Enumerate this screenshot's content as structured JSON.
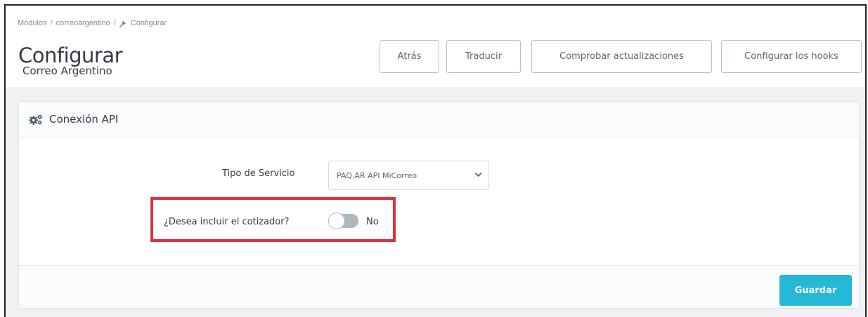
{
  "breadcrumb": {
    "items": [
      "Módulos",
      "correoargentino",
      "Configurar"
    ],
    "separator": "/"
  },
  "header": {
    "title": "Configurar",
    "subtitle": "Correo Argentino"
  },
  "toolbar": {
    "back_label": "Atrás",
    "translate_label": "Traducir",
    "check_updates_label": "Comprobar actualizaciones",
    "hooks_label": "Configurar los hooks"
  },
  "panel": {
    "title": "Conexión API",
    "icon": "cogs-icon",
    "service_label": "Tipo de Servicio",
    "service_value": "PAQ.AR API MiCorreo",
    "cotizador_label": "¿Desea incluir el cotizador?",
    "cotizador_state": "No",
    "cotizador_enabled": false,
    "save_label": "Guardar"
  },
  "colors": {
    "accent": "#25b9d7",
    "highlight": "#d9333f",
    "background": "#eff1f2",
    "text": "#363a41"
  }
}
